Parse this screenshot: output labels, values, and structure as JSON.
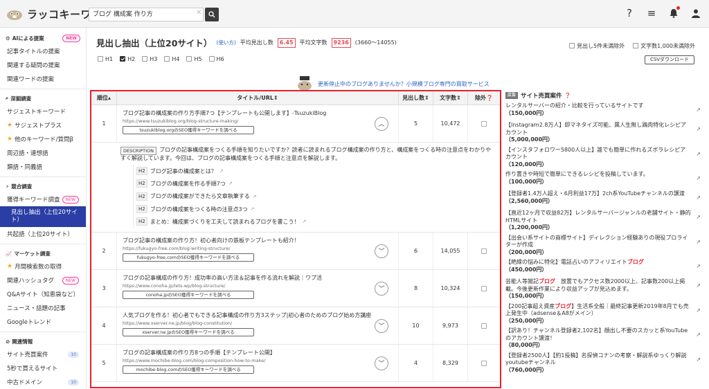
{
  "app": {
    "logo_text": "ラッコキーワード"
  },
  "search": {
    "value": "ブログ 構成案 作り方"
  },
  "header_icons": [
    "help-icon",
    "menu-icon",
    "bell-icon",
    "user-icon"
  ],
  "sidebar": {
    "sections": [
      {
        "title": "AIによる提案",
        "icon": "robot-icon",
        "badge": "NEW",
        "items": [
          {
            "label": "記事タイトルの提案"
          },
          {
            "label": "関連する疑問の提案"
          },
          {
            "label": "関連ワードの提案"
          }
        ]
      },
      {
        "title": "深掘調査",
        "icon": "search-icon",
        "items": [
          {
            "label": "サジェストキーワード"
          },
          {
            "label": "サジェストプラス",
            "star": true
          },
          {
            "label": "他のキーワード/質問β",
            "star": true
          },
          {
            "label": "周辺語・連想語"
          },
          {
            "label": "類語・同義語"
          }
        ]
      },
      {
        "title": "競合調査",
        "icon": "bolt-icon",
        "items": [
          {
            "label": "獲得キーワード調査",
            "badge": "NEW"
          },
          {
            "label": "見出し抽出（上位20サイト）",
            "active": true
          },
          {
            "label": "共起語（上位20サイト）"
          }
        ]
      },
      {
        "title": "マーケット調査",
        "icon": "chart-icon",
        "items": [
          {
            "label": "月間検索数の取得",
            "star": true
          },
          {
            "label": "関連ハッシュタグ",
            "badge": "NEW"
          },
          {
            "label": "Q&Aサイト（知恵袋など）"
          },
          {
            "label": "ニュース・話題の記事"
          },
          {
            "label": "Googleトレンド"
          }
        ]
      },
      {
        "title": "関連情報",
        "icon": "link-icon",
        "items": [
          {
            "label": "サイト売買案件",
            "count": "10"
          },
          {
            "label": "5秒で買えるサイト"
          },
          {
            "label": "中古ドメイン",
            "count": "10"
          }
        ]
      }
    ]
  },
  "page": {
    "title": "見出し抽出（上位20サイト）",
    "howto": "(使い方)",
    "avg_heading_label": "平均見出し数",
    "avg_heading_value": "6.45",
    "avg_chars_label": "平均文字数",
    "avg_chars_value": "9236",
    "chars_range": "(3660〜14055)",
    "h_filters": [
      {
        "label": "H1",
        "checked": false
      },
      {
        "label": "H2",
        "checked": true
      },
      {
        "label": "H3",
        "checked": false
      },
      {
        "label": "H4",
        "checked": false
      },
      {
        "label": "H5",
        "checked": false
      },
      {
        "label": "H6",
        "checked": false
      }
    ],
    "opt1": "見出し5件未満除外",
    "opt2": "文字数1,000未満除外",
    "csv": "CSVダウンロード",
    "banner": "更新停止中のブログありませんか？小規模ブログ専門の買取サービス"
  },
  "table": {
    "headers": {
      "rank": "順位",
      "title": "タイトル/URL",
      "headings": "見出し数",
      "chars": "文字数",
      "exclude": "除外"
    },
    "rows": [
      {
        "rank": "1",
        "title": "ブログ記事の構成案の作り方手順7つ【テンプレートも公開します】-TsuzukiBlog",
        "url": "https://www.tsuzukiblog.org/blog-structure-making/",
        "btn": "tsuzukiblog.orgのSEO獲得キーワードを調べる",
        "headings": "5",
        "chars": "10,472",
        "expanded": true
      },
      {
        "rank": "2",
        "title": "ブログ記事の構成案の作り方！初心者向けの鉄板テンプレートも紹介！",
        "url": "https://fukugyo-free.com/blog-writing-structure/",
        "btn": "fukugyo-free.comのSEO獲得キーワードを調べる",
        "headings": "6",
        "chars": "14,055"
      },
      {
        "rank": "3",
        "title": "ブログの記事構成の作り方！成功率の高い方法＆記事を作る流れを解説｜ワプ活",
        "url": "https://www.conoha.jp/lets-wp/blog-structure/",
        "btn": "conoha.jpのSEO獲得キーワードを調べる",
        "headings": "8",
        "chars": "10,324"
      },
      {
        "rank": "4",
        "title": "人気ブログを作る！初心者でもできる記事構成の作り方3ステップ|初心者のためのブログ始め方講座",
        "url": "https://www.xserver.ne.jp/blog/blog-constitution/",
        "btn": "xserver.ne.jpのSEO獲得キーワードを調べる",
        "headings": "10",
        "chars": "9,973"
      },
      {
        "rank": "5",
        "title": "ブログの記事構成案の作り方8つの手順【テンプレート公開】",
        "url": "https://www.mochibe-blog.com/blog-composition-how-to-make/",
        "btn": "mochibe-blog.comのSEO獲得キーワードを調べる",
        "headings": "4",
        "chars": "8,329"
      }
    ],
    "detail": {
      "desc_label": "DESCRIPTION",
      "description": "ブログの記事構成案をつくる手順を知りたいですか？読者に読まれるブログ構成案の作り方と、構成案をつくる時の注意点をわかりやすく解説しています。今回は、ブログの記事構成案をつくる手順と注意点を解説します。",
      "headings": [
        {
          "tag": "H2",
          "text": "ブログ記事の構成案とは？"
        },
        {
          "tag": "H2",
          "text": "ブログの構成案を作る手順7つ"
        },
        {
          "tag": "H2",
          "text": "ブログの構成案ができたら文章執筆する"
        },
        {
          "tag": "H2",
          "text": "ブログの構成案をつくる時の注意点3つ"
        },
        {
          "tag": "H2",
          "text": "まとめ：構成案づくりを工夫して読まれるブログを書こう！"
        }
      ]
    }
  },
  "side": {
    "ad_label": "広告",
    "title": "サイト売買案件",
    "items": [
      {
        "text": "レンタルサーバーの紹介・比較を行っているサイトです",
        "price": "（150,000円）"
      },
      {
        "text": "【Instagram2.8万人】即マネタイズ可能、属人生無し鶏肉特化レシピアカウント",
        "price": "（5,000,000円）"
      },
      {
        "text": "【インスタフォロワー5800人以上】誰でも簡単に作れるズボラレシピアカウント",
        "price": "（120,000円）"
      },
      {
        "text": "作り置きや時短で簡単にできるレシピを投稿しています。",
        "price": "（100,000円）"
      },
      {
        "text": "【登録者1.4万人超え・6月利益17万】2ch系YouTubeチャンネルの譲渡",
        "price": "（2,560,000円）"
      },
      {
        "text": "【直近12ヶ月で収益82万】レンタルサーバージャンルの老舗サイト・静的HTMLサイト",
        "price": "（1,200,000円）"
      },
      {
        "text": "【出会い系サイトの商標サイト】ディレクション経験ありの現役プロライターが作成",
        "price": "（200,000円）"
      },
      {
        "text": "【絶縁の悩みに特化】電話占いのアフィリエイトブログ",
        "price": "（450,000円）"
      },
      {
        "text": "芸能人等雑記ブログ　放置でもアクセス数2000以上、記事数200以上掲載。今後更新作業により収益アップが見込めます。",
        "price": "（150,000円）"
      },
      {
        "text": "【200記事超え資産ブログ】生活系全般｜最終記事更新2019年8月でも売上発生中（adsense＆A8がメイン）",
        "price": "（250,000円）"
      },
      {
        "text": "【訳あり！チャンネル登録者2,102名】顔出し不要のスカッと系YouTubeのアカウント譲渡！",
        "price": "（80,000円）"
      },
      {
        "text": "【登録者2500人】【約1投稿】名探偵コナンの考察・解説系ゆっくり解説youtubeチャンネル",
        "price": "（760,000円）"
      }
    ]
  }
}
